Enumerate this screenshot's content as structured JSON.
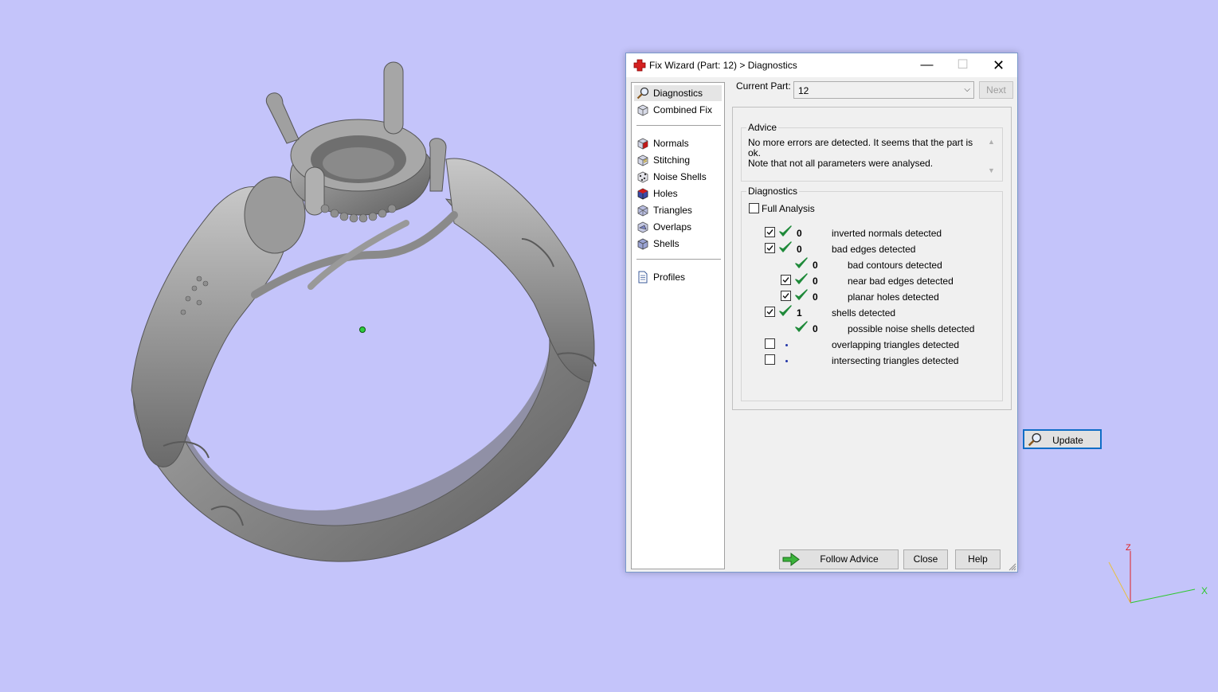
{
  "colors": {
    "background": "#c4c4fa",
    "model": "#8c8c8c",
    "check_green": "#1f8a3a",
    "dot_blue": "#2336a8",
    "focus_blue": "#0f6dc6",
    "axis_x": "#2ec82e",
    "axis_y": "#e8c040",
    "axis_z": "#e02020"
  },
  "viewport": {
    "model": "ring 3D model",
    "axis_labels": {
      "x": "X",
      "z": "Z"
    }
  },
  "window": {
    "title": "Fix Wizard (Part: 12) > Diagnostics",
    "title_icon": "red-cross-icon",
    "controls": {
      "minimize": "—",
      "maximize": "☐",
      "close": "✕"
    }
  },
  "nav": {
    "items": [
      {
        "label": "Diagnostics",
        "icon": "magnifier-icon",
        "selected": true
      },
      {
        "label": "Combined Fix",
        "icon": "cube-icon"
      },
      {
        "label": "Normals",
        "icon": "normals-cube-icon"
      },
      {
        "label": "Stitching",
        "icon": "stitching-cube-icon"
      },
      {
        "label": "Noise Shells",
        "icon": "noise-shells-icon"
      },
      {
        "label": "Holes",
        "icon": "holes-cube-icon"
      },
      {
        "label": "Triangles",
        "icon": "triangles-cube-icon"
      },
      {
        "label": "Overlaps",
        "icon": "overlaps-cube-icon"
      },
      {
        "label": "Shells",
        "icon": "shells-cube-icon"
      },
      {
        "label": "Profiles",
        "icon": "document-icon"
      }
    ]
  },
  "current_part": {
    "label": "Current Part:",
    "value": "12",
    "next_label": "Next"
  },
  "advice": {
    "title": "Advice",
    "line1": "No more errors are detected. It seems that the part is ok.",
    "line2": "Note that not all parameters were analysed."
  },
  "diagnostics": {
    "title": "Diagnostics",
    "full_analysis_label": "Full Analysis",
    "full_analysis_checked": false,
    "rows": [
      {
        "checkbox": true,
        "checked": true,
        "status": "ok",
        "count": "0",
        "label": "inverted normals detected"
      },
      {
        "checkbox": true,
        "checked": true,
        "status": "ok",
        "count": "0",
        "label": "bad edges detected"
      },
      {
        "checkbox": false,
        "checked": false,
        "status": "ok",
        "count": "0",
        "label": "bad contours detected"
      },
      {
        "checkbox": true,
        "checked": true,
        "status": "ok",
        "count": "0",
        "label": "near bad edges detected"
      },
      {
        "checkbox": true,
        "checked": true,
        "status": "ok",
        "count": "0",
        "label": "planar holes detected"
      },
      {
        "checkbox": true,
        "checked": true,
        "status": "ok",
        "count": "1",
        "label": "shells detected"
      },
      {
        "checkbox": false,
        "checked": false,
        "status": "ok",
        "count": "0",
        "label": "possible noise shells detected"
      },
      {
        "checkbox": true,
        "checked": false,
        "status": "pending",
        "count": "",
        "label": "overlapping triangles detected"
      },
      {
        "checkbox": true,
        "checked": false,
        "status": "pending",
        "count": "",
        "label": "intersecting triangles detected"
      }
    ],
    "update_label": "Update"
  },
  "footer": {
    "follow_advice_label": "Follow Advice",
    "close_label": "Close",
    "help_label": "Help"
  }
}
